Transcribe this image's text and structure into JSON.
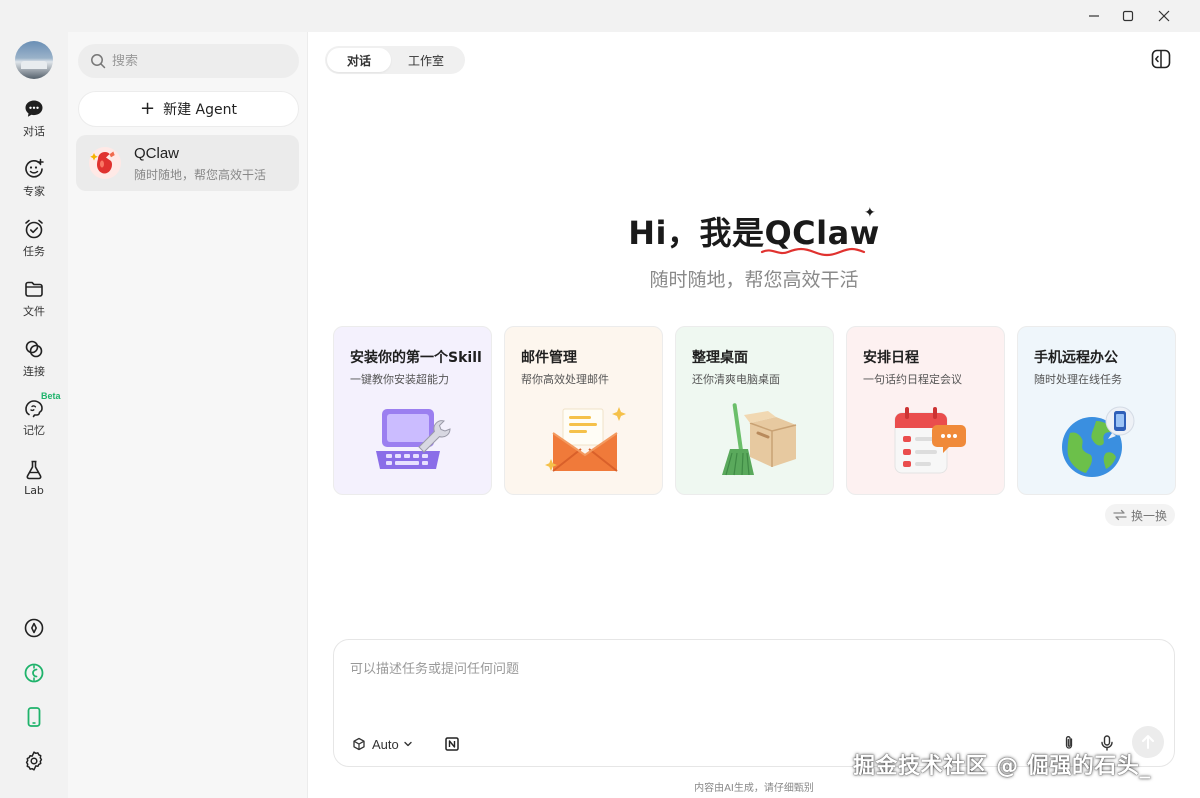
{
  "window": {
    "controls": [
      "minimize",
      "maximize",
      "close"
    ]
  },
  "rail": {
    "items": [
      {
        "label": "对话",
        "icon": "chat-bubble-icon"
      },
      {
        "label": "专家",
        "icon": "smile-face-icon"
      },
      {
        "label": "任务",
        "icon": "alarm-check-icon"
      },
      {
        "label": "文件",
        "icon": "folder-icon"
      },
      {
        "label": "连接",
        "icon": "link-loop-icon"
      },
      {
        "label": "记忆",
        "icon": "brain-icon",
        "badge": "Beta"
      },
      {
        "label": "Lab",
        "icon": "flask-icon"
      }
    ],
    "bottom_icons": [
      "compass-icon",
      "shield-badge-icon",
      "phone-icon",
      "gear-icon"
    ]
  },
  "panel": {
    "search_placeholder": "搜索",
    "new_agent_label": "新建 Agent",
    "agents": [
      {
        "name": "QClaw",
        "subtitle": "随时随地，帮您高效干活"
      }
    ]
  },
  "main": {
    "tabs": [
      {
        "label": "对话",
        "active": true
      },
      {
        "label": "工作室",
        "active": false
      }
    ],
    "hero": {
      "greeting": "Hi，我是",
      "brand": "QClaw",
      "subtitle": "随时随地，帮您高效干活"
    },
    "cards": [
      {
        "title": "安装你的第一个Skill",
        "subtitle": "一键教你安装超能力",
        "icon": "laptop-wrench-icon",
        "bg": "#f4f1fd"
      },
      {
        "title": "邮件管理",
        "subtitle": "帮你高效处理邮件",
        "icon": "envelope-icon",
        "bg": "#fdf6ee"
      },
      {
        "title": "整理桌面",
        "subtitle": "还你清爽电脑桌面",
        "icon": "broom-box-icon",
        "bg": "#eff8f1"
      },
      {
        "title": "安排日程",
        "subtitle": "一句话约日程定会议",
        "icon": "calendar-icon",
        "bg": "#fdf1f1"
      },
      {
        "title": "手机远程办公",
        "subtitle": "随时处理在线任务",
        "icon": "globe-phone-icon",
        "bg": "#eff6fb"
      }
    ],
    "shuffle_label": "换一换",
    "composer": {
      "placeholder": "可以描述任务或提问任何问题",
      "model": "Auto"
    },
    "disclaimer": "内容由AI生成，请仔细甄别"
  },
  "watermark": "掘金技术社区 @ 倔强的石头_",
  "colors": {
    "accent_green": "#1fb36b",
    "brand_red": "#e0322f"
  }
}
